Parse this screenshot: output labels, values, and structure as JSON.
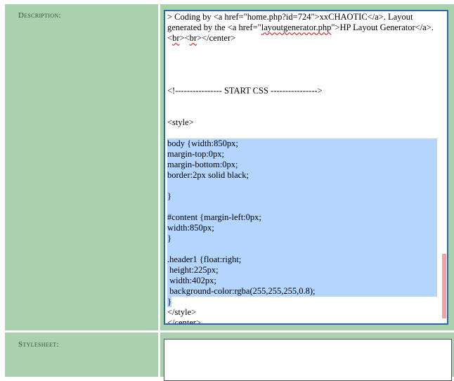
{
  "labels": {
    "description": "Description:",
    "stylesheet": "Stylesheet:"
  },
  "description_editor": {
    "para1_a": "> Coding by <a href=\"home.php?id=724\">xxCHAOTIC</a>. Layout generated by the <a href=\"",
    "para1_link": "layoutgenerator.php",
    "para1_b": "\">HP Layout Generator</a>.",
    "para1_c1": "<",
    "para1_br1": "br",
    "para1_c2": "><",
    "para1_br2": "br",
    "para1_c3": "></center>",
    "start_css": "<!---------------- START CSS ---------------->",
    "style_open": "<style>",
    "selected_lines": [
      "body {width:850px;",
      "margin-top:0px;",
      "margin-bottom:0px;",
      "border:2px solid black;",
      "",
      "}",
      "",
      "#content {margin-left:0px;",
      "width:850px;",
      "}",
      "",
      ".header1 {float:right;",
      " height:225px;",
      " width:402px;",
      " background-color:rgba(255,255,255,0.8);",
      "}"
    ],
    "style_close": "</style>",
    "center_close": "</center>"
  },
  "stylesheet_editor": {
    "value": ""
  },
  "colors": {
    "form_bg": "#a9d1ad",
    "selection": "#b4d5fd",
    "focus_border": "#2f64ae",
    "scroll_thumb": "#f2a1a1"
  }
}
